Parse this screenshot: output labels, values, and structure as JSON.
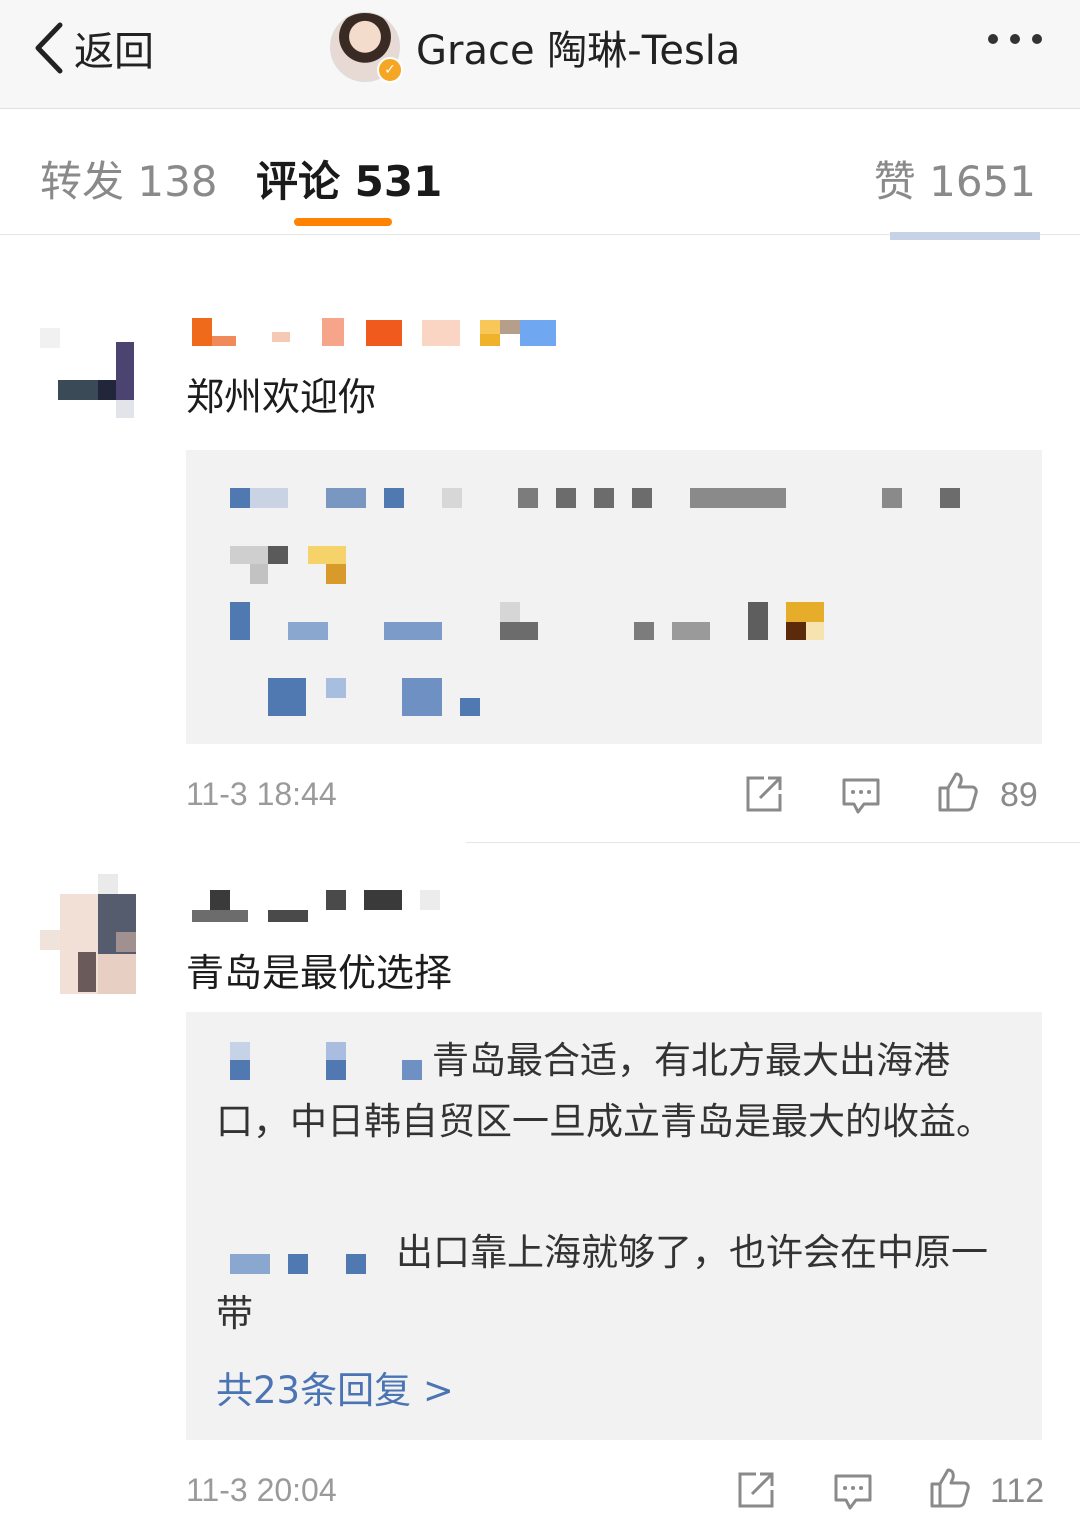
{
  "header": {
    "back_label": "返回",
    "title": "Grace 陶琳-Tesla",
    "verified_badge": "✓"
  },
  "tabs": [
    {
      "label": "转发 138",
      "active": false
    },
    {
      "label": "评论 531",
      "active": true
    },
    {
      "label": "赞 1651",
      "active": false
    }
  ],
  "colors": {
    "accent": "#ff8200",
    "link": "#4a74b3",
    "reply_bg": "#f2f2f2",
    "verified": "#f5a623"
  },
  "comments": [
    {
      "text": "郑州欢迎你",
      "time": "11-3 18:44",
      "likes": "89"
    },
    {
      "text": "青岛是最优选择",
      "replies": [
        {
          "text": "青岛最合适，有北方最大出海港口，中日韩自贸区一旦成立青岛是最大的收益。"
        },
        {
          "text": "出口靠上海就够了，也许会在中原一带"
        }
      ],
      "more_replies": "共23条回复 >",
      "time": "11-3 20:04",
      "likes": "112"
    }
  ],
  "icons": [
    "back-chevron-icon",
    "verified-icon",
    "more-dots-icon",
    "share-icon",
    "comment-icon",
    "like-icon"
  ]
}
